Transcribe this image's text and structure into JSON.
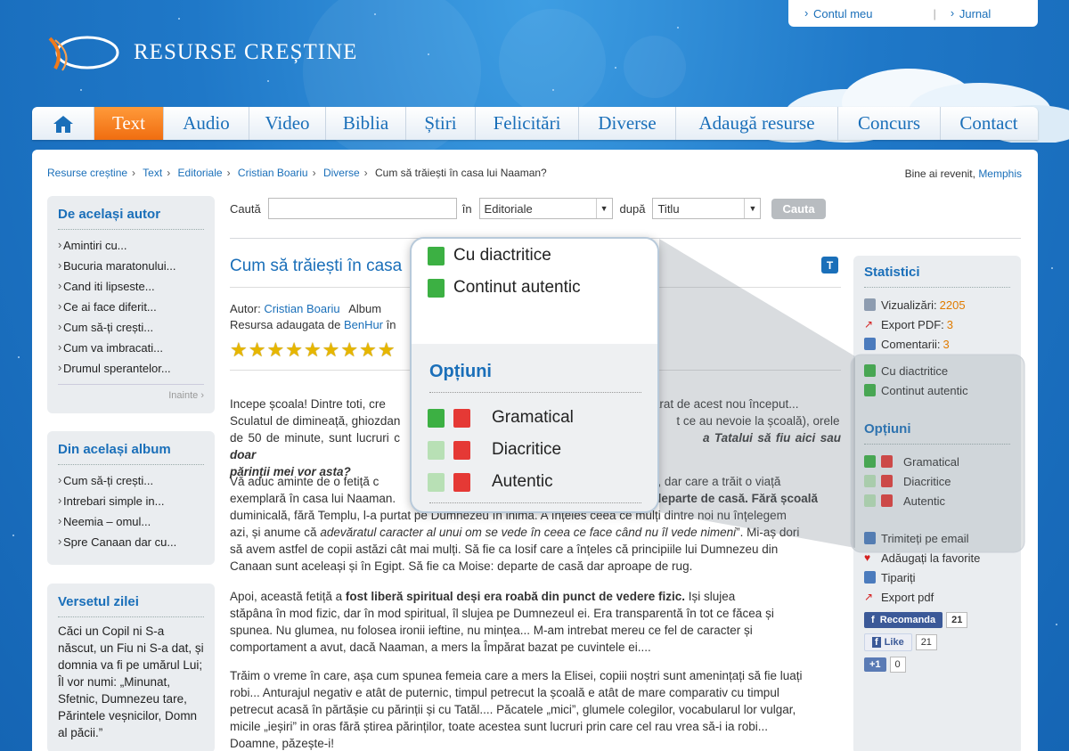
{
  "header": {
    "site_name": "RESURSE CREȘTINE",
    "account_link": "Contul meu",
    "journal_link": "Jurnal"
  },
  "nav": {
    "items": [
      "Text",
      "Audio",
      "Video",
      "Biblia",
      "Știri",
      "Felicitări",
      "Diverse",
      "Adaugă resurse",
      "Concurs",
      "Contact"
    ],
    "active": "Text"
  },
  "breadcrumb": [
    "Resurse creștine",
    "Text",
    "Editoriale",
    "Cristian Boariu",
    "Diverse",
    "Cum să trăiești în casa lui Naaman?"
  ],
  "welcome": {
    "text": "Bine ai revenit,",
    "user": "Memphis"
  },
  "search": {
    "label": "Caută",
    "in_label": "în",
    "in_value": "Editoriale",
    "by_label": "după",
    "by_value": "Titlu",
    "button": "Cauta"
  },
  "sidebar": {
    "same_author": {
      "title": "De același autor",
      "items": [
        "Amintiri cu...",
        "Bucuria maratonului...",
        "Cand iti lipseste...",
        "Ce ai face diferit...",
        "Cum să-ți crești...",
        "Cum va imbracati...",
        "Drumul sperantelor..."
      ],
      "next": "Inainte"
    },
    "same_album": {
      "title": "Din același album",
      "items": [
        "Cum să-ți crești...",
        "Intrebari simple in...",
        "Neemia – omul...",
        "Spre Canaan dar cu..."
      ]
    },
    "verse": {
      "title": "Versetul zilei",
      "text": "Căci un Copil ni S-a născut, un Fiu ni S-a dat, și domnia va fi pe umărul Lui; Îl vor numi: „Minunat, Sfetnic, Dumnezeu tare, Părintele veșnicilor, Domn al păcii.”"
    }
  },
  "article": {
    "title": "Cum să trăiești în casa",
    "author_label": "Autor:",
    "author": "Cristian Boariu",
    "album_label": "Album",
    "added_by_label": "Resursa adaugata de",
    "added_by": "BenHur",
    "added_by_suffix": "în",
    "rating": 9,
    "paragraphs": [
      {
        "p1": "Incepe școala! Dintre toti, cre",
        "p1b": "ărat de acest nou început...",
        "p2": "Sculatul de dimineață, ghiozdan",
        "p2b": "t ce au nevoie la școală), orele",
        "p3": "de 50 de minute, sunt lucruri c",
        "p3b": "a Tatalui să fiu aici sau doar",
        "p4": "părinții mei vor asta?"
      }
    ],
    "para2": {
      "l1a": "Vă aduc aminte de o fetiță c",
      "l1b": "Bible, dar care a trăit o viață",
      "l2a": "exemplară în casa lui Naaman.",
      "l2b": "departe de casă.",
      "l2c": "Fără școală",
      "l3": "duminicală, fără Templu, l-a purtat pe Dumnezeu în inimă. A înțeles ceea ce mulți dintre noi nu înțelegem",
      "l4a": "azi, și anume că",
      "l4b": "adevăratul caracter al unui om se vede în ceea ce face când nu îl vede nimeni",
      "l4c": "”. Mi-aș dori",
      "l5": "să avem astfel de copii astăzi cât mai mulți. Să fie ca Iosif care a înțeles că principiile lui Dumnezeu din",
      "l6": "Canaan sunt aceleași și în Egipt. Să fie ca Moise: departe de casă dar aproape de rug."
    },
    "para3": {
      "l1a": "Apoi, această fetiță a",
      "l1b": "fost liberă spiritual deși era roabă din punct de vedere fizic.",
      "l1c": "Iși slujea",
      "l2": "stăpâna în mod fizic, dar în mod spiritual, îl slujea pe Dumnezeul ei. Era transparentă în tot ce făcea și",
      "l3": "spunea. Nu glumea, nu folosea ironii ieftine, nu mințea... M-am intrebat mereu ce fel de caracter și",
      "l4": "comportament a avut, dacă Naaman, a mers la Împărat bazat pe cuvintele ei...."
    },
    "para4": {
      "l1": "Trăim o vreme în care, așa cum spunea femeia care a mers la Elisei, copiii noștri sunt amenințați să fie luați",
      "l2": "robi... Anturajul negativ e atât de puternic, timpul petrecut la școală e atât de mare comparativ cu timpul",
      "l3": "petrecut acasă în părtășie cu părinții și cu Tatăl.... Păcatele „mici”, glumele colegilor, vocabularul lor vulgar,",
      "l4": "micile „ieșiri” in oras fără știrea părinților, toate acestea sunt lucruri prin care cel rau vrea să-i ia robi...",
      "l5": "Doamne, păzește-i!"
    }
  },
  "stats": {
    "title": "Statistici",
    "views_label": "Vizualizări:",
    "views": "2205",
    "pdf_label": "Export PDF:",
    "pdf": "3",
    "comments_label": "Comentarii:",
    "comments": "3",
    "with_diacritics": "Cu diactritice",
    "authentic": "Continut autentic",
    "options_title": "Opțiuni",
    "opt_grammar": "Gramatical",
    "opt_diacritics": "Diacritice",
    "opt_authentic": "Autentic",
    "email": "Trimiteți pe email",
    "favorites": "Adăugați la favorite",
    "print": "Tipariți",
    "export_pdf": "Export pdf",
    "fb_recommend": "Recomanda",
    "fb_recommend_count": "21",
    "fb_like": "Like",
    "fb_like_count": "21",
    "gplus": "+1",
    "gplus_count": "0"
  },
  "magnifier": {
    "with_diacritics": "Cu diactritice",
    "authentic": "Continut autentic",
    "options_title": "Opțiuni",
    "opt_grammar": "Gramatical",
    "opt_diacritics": "Diacritice",
    "opt_authentic": "Autentic"
  },
  "colors": {
    "brand_blue": "#1a6fb9",
    "active_tab": "#f06d10",
    "accent_orange": "#e07b00"
  }
}
